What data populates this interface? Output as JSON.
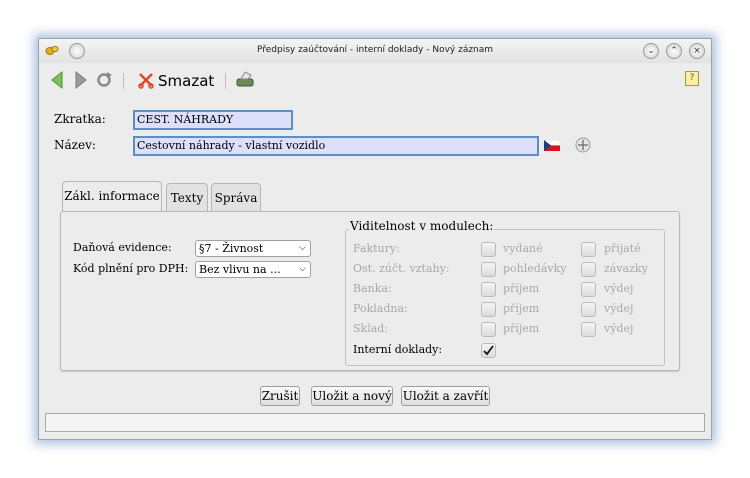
{
  "window": {
    "title": "Předpisy zaúčtování - interní doklady - Nový záznam",
    "buttons": {
      "minimize": "⌄",
      "maximize": "⌃",
      "close": "×"
    }
  },
  "toolbar": {
    "delete_label": "Smazat",
    "help_label": "?"
  },
  "form": {
    "zkratka_label": "Zkratka:",
    "zkratka_value": "CEST. NÁHRADY",
    "nazev_label": "Název:",
    "nazev_value": "Cestovní náhrady - vlastní vozidlo"
  },
  "tabs": [
    {
      "label": "Zákl. informace",
      "active": true
    },
    {
      "label": "Texty",
      "active": false
    },
    {
      "label": "Správa",
      "active": false
    }
  ],
  "basic": {
    "tax_label": "Daňová evidence:",
    "tax_value": "§7 - Živnost",
    "vat_label": "Kód plnění pro DPH:",
    "vat_value": "Bez vlivu na ..."
  },
  "visibility": {
    "title": "Viditelnost v modulech:",
    "modules": [
      {
        "label": "Faktury:",
        "opt1": "vydané",
        "opt2": "přijaté"
      },
      {
        "label": "Ost. zúčt. vztahy:",
        "opt1": "pohledávky",
        "opt2": "závazky"
      },
      {
        "label": "Banka:",
        "opt1": "příjem",
        "opt2": "výdej"
      },
      {
        "label": "Pokladna:",
        "opt1": "příjem",
        "opt2": "výdej"
      },
      {
        "label": "Sklad:",
        "opt1": "příjem",
        "opt2": "výdej"
      }
    ],
    "internal_label": "Interní doklady:",
    "internal_checked": true
  },
  "buttons": {
    "cancel": "Zrušit",
    "save_new": "Uložit a nový",
    "save_close": "Uložit a zavřít"
  },
  "icons": [
    "app-icon",
    "menu-icon",
    "back-arrow-icon",
    "forward-arrow-icon",
    "refresh-icon",
    "delete-icon",
    "print-icon",
    "help-icon",
    "flag-cz-icon",
    "sum-icon",
    "checkmark-icon"
  ]
}
